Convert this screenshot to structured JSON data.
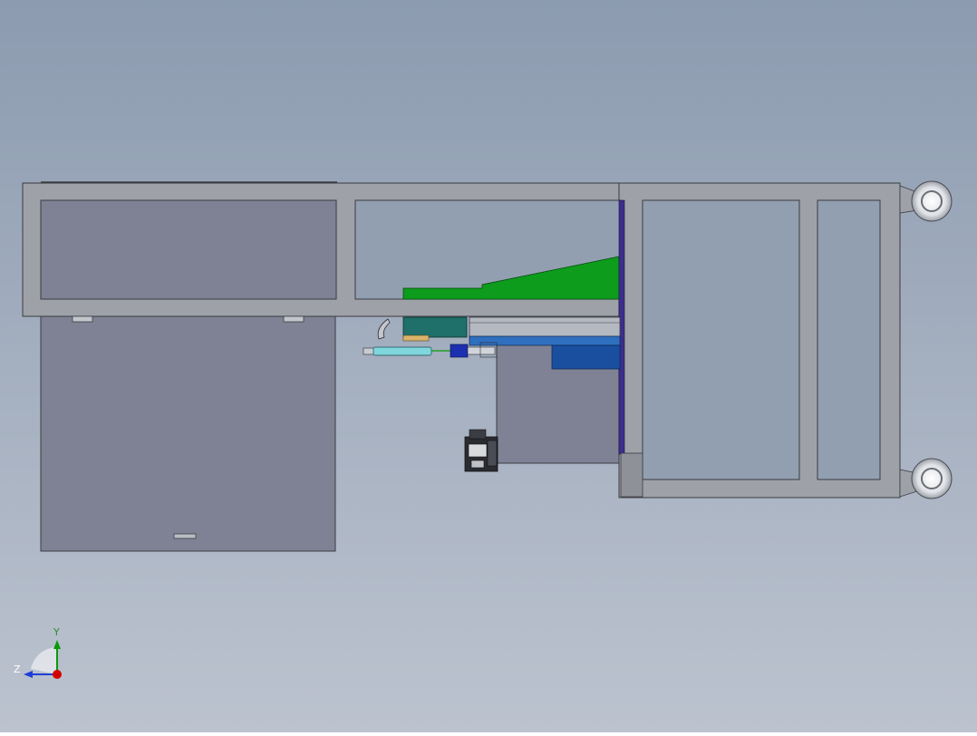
{
  "viewport": {
    "background_top": "#8c9bb0",
    "background_bottom": "#bcc3cf"
  },
  "colors": {
    "frame_fill": "#9ea1a8",
    "frame_stroke": "#3a3c42",
    "cabinet_fill": "#7f8294",
    "opening_fill": "#929fb1",
    "green_plate": "#0d9c1c",
    "teal_block": "#1f6f6a",
    "blue_plate": "#2f6fbf",
    "dark_blue": "#1a4fa0",
    "purple_edge": "#3c2e8c",
    "cylinder": "#7fd6dc",
    "valve_blue": "#1c2fb0",
    "wheel_rim": "#e9ebee",
    "axis_x": "#d40000",
    "axis_y": "#0a9a0a",
    "axis_z": "#1f3fd6"
  },
  "triad": {
    "y_label": "Y",
    "z_label": "Z",
    "icon": "coordinate-triad-icon"
  }
}
